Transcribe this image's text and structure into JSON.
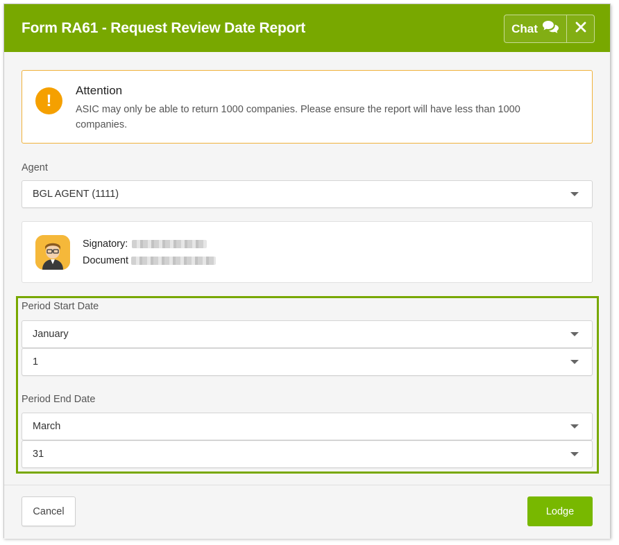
{
  "modal": {
    "title": "Form RA61 - Request Review Date Report",
    "chat_label": "Chat"
  },
  "alert": {
    "icon": "exclamation",
    "title": "Attention",
    "text": "ASIC may only be able to return 1000 companies. Please ensure the report will have less than 1000 companies."
  },
  "agent": {
    "label": "Agent",
    "value": "BGL AGENT (1111)"
  },
  "signatory": {
    "signatory_label": "Signatory:",
    "document_label": "Document"
  },
  "period_start": {
    "label": "Period Start Date",
    "month": "January",
    "day": "1"
  },
  "period_end": {
    "label": "Period End Date",
    "month": "March",
    "day": "31"
  },
  "footer": {
    "cancel_label": "Cancel",
    "lodge_label": "Lodge"
  },
  "colors": {
    "header": "#78a800",
    "lodge_button": "#78b800",
    "alert_border": "#f0b13a",
    "alert_icon": "#f5a000",
    "highlight_border": "#78a800"
  }
}
